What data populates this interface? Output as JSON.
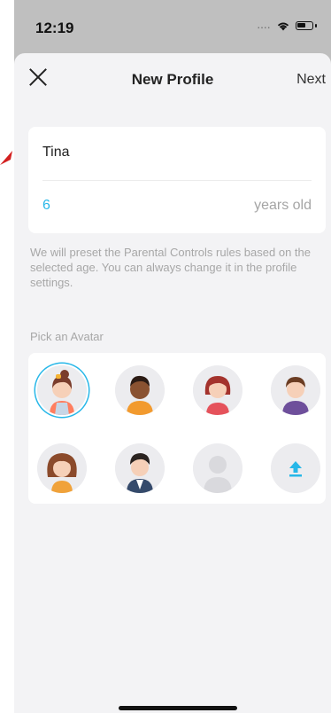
{
  "status": {
    "time": "12:19",
    "signal_dots": "....",
    "wifi_icon": "wifi-icon",
    "battery_icon": "battery-icon"
  },
  "nav": {
    "title": "New Profile",
    "next_label": "Next",
    "close_icon": "close-icon"
  },
  "form": {
    "name_value": "Tina",
    "age_value": "6",
    "age_unit": "years old"
  },
  "info_text": "We will preset the Parental Controls rules based on the selected age. You can always change it in the profile settings.",
  "avatar_section": {
    "label": "Pick an Avatar",
    "avatars": [
      "girl-bun-avatar",
      "boy-dark-skin-avatar",
      "girl-red-hair-avatar",
      "boy-purple-shirt-avatar",
      "girl-curly-hair-avatar",
      "boy-suit-avatar",
      "placeholder-avatar",
      "upload-icon"
    ],
    "selected_index": 0
  },
  "colors": {
    "accent": "#27b7e8",
    "background": "#f3f3f5",
    "card": "#ffffff",
    "muted_text": "#a7a7a7"
  }
}
